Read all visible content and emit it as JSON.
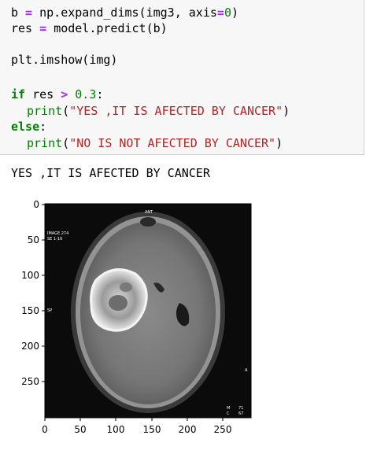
{
  "code": {
    "line1": {
      "var": "b",
      "eq": " = ",
      "rest": "np.expand_dims(img3, axis",
      "eq2": "=",
      "num": "0",
      "close": ")"
    },
    "line2": {
      "var": "res",
      "eq": " = ",
      "rest": "model.predict(b)"
    },
    "line3": {
      "text": "plt.imshow(img)"
    },
    "line4": {
      "kw": "if",
      "mid": " res ",
      "op": ">",
      "num": " 0.3",
      "colon": ":"
    },
    "line5": {
      "fn": "print",
      "open": "(",
      "str": "\"YES ,IT IS AFECTED BY CANCER\"",
      "close": ")"
    },
    "line6": {
      "kw": "else",
      "colon": ":"
    },
    "line7": {
      "fn": "print",
      "open": "(",
      "str": "\"NO IS NOT AFECTED BY CANCER\"",
      "close": ")"
    }
  },
  "output_text": "YES ,IT IS AFECTED BY CANCER",
  "plot": {
    "y_ticks": [
      "0",
      "50",
      "100",
      "150",
      "200",
      "250"
    ],
    "x_ticks": [
      "0",
      "50",
      "100",
      "150",
      "200",
      "250"
    ],
    "scan_labels": {
      "top": "ANT",
      "left1": "IMAGE 274",
      "left2": "SE 1-16",
      "mid_left": "SP",
      "right": "A",
      "br1": "M",
      "br2": "C",
      "br3": "71",
      "br4": "67"
    }
  },
  "colors": {
    "cell_bg": "#f7f7f7",
    "keyword": "#008000",
    "operator": "#aa22ff",
    "string": "#ba2121"
  }
}
